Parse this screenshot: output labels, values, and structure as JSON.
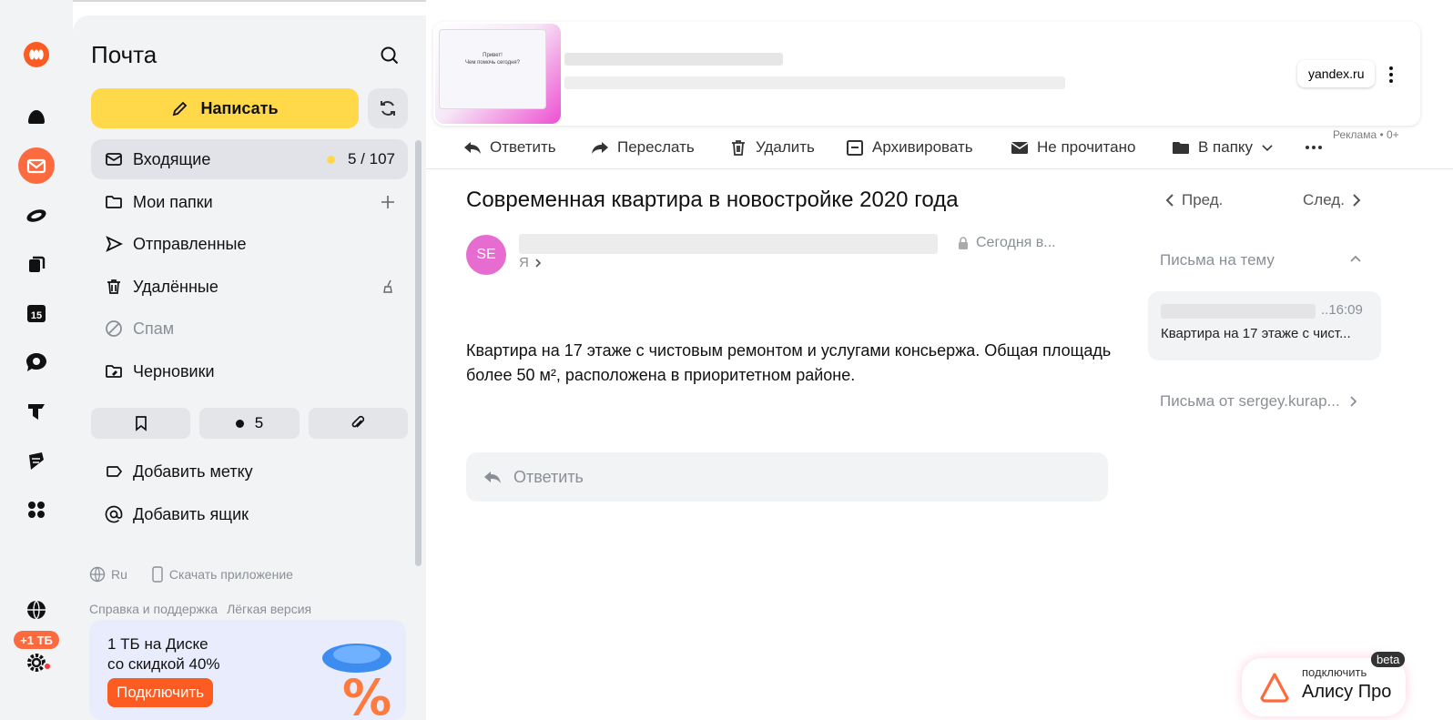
{
  "sidebar": {
    "title": "Почта",
    "compose_label": "Написать",
    "folders": [
      {
        "label": "Входящие",
        "count": "5 / 107"
      },
      {
        "label": "Мои папки"
      },
      {
        "label": "Отправленные"
      },
      {
        "label": "Удалённые"
      },
      {
        "label": "Спам"
      },
      {
        "label": "Черновики"
      }
    ],
    "unread_chip_count": "5",
    "add_label": "Добавить метку",
    "add_mailbox": "Добавить ящик",
    "lang": "Ru",
    "download_app": "Скачать приложение",
    "help": "Справка и поддержка",
    "lite": "Лёгкая версия",
    "promo_line1": "1 ТБ на Диске",
    "promo_line2": "со скидкой 40%",
    "promo_button": "Подключить"
  },
  "rail": {
    "tb_badge": "+1 ТБ",
    "calendar_day": "15"
  },
  "ad": {
    "thumb_line1": "Привет!",
    "thumb_line2": "Чем помочь сегодня?",
    "domain": "yandex.ru",
    "label": "Реклама  •  0+"
  },
  "toolbar": {
    "reply": "Ответить",
    "forward": "Переслать",
    "delete": "Удалить",
    "archive": "Архивировать",
    "unread": "Не прочитано",
    "to_folder": "В папку"
  },
  "message": {
    "subject": "Современная квартира в новостройке 2020 года",
    "avatar": "SE",
    "date": "Сегодня в...",
    "to": "Я",
    "body": "Квартира на 17 этаже с чистовым ремонтом и услугами консьержа. Общая площадь более 50 м², расположена в приоритетном районе.",
    "reply_placeholder": "Ответить"
  },
  "thread": {
    "prev": "Пред.",
    "next": "След.",
    "heading": "Письма на тему",
    "item_time": "..16:09",
    "item_snippet": "Квартира на 17 этаже с чист...",
    "from_link": "Письма от sergey.kurap..."
  },
  "alice": {
    "sub": "подключить",
    "main": "Алису Про",
    "beta": "beta"
  },
  "colors": {
    "accent_yellow": "#ffd94a",
    "brand_orange": "#fc6b3f",
    "avatar_pink": "#e66ccf"
  }
}
